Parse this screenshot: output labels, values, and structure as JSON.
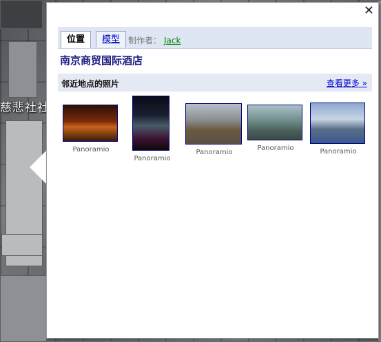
{
  "map": {
    "place_label": "慈悲社社"
  },
  "balloon": {
    "close_glyph": "✕",
    "tabs": [
      {
        "label": "位置",
        "active": true
      },
      {
        "label": "模型",
        "active": false
      }
    ],
    "author_prefix": "制作者：",
    "author_name": "Jack",
    "place_title": "南京商贸国际酒店",
    "nearby": {
      "title": "邻近地点的照片",
      "more_label": "查看更多 »"
    },
    "photos": [
      {
        "caption": "Panoramio"
      },
      {
        "caption": "Panoramio"
      },
      {
        "caption": "Panoramio"
      },
      {
        "caption": "Panoramio"
      },
      {
        "caption": "Panoramio"
      }
    ]
  },
  "colors": {
    "link": "#0000cc",
    "author_link": "#008000",
    "tab_bar": "#dfe6f3",
    "title": "#1a1a80"
  }
}
